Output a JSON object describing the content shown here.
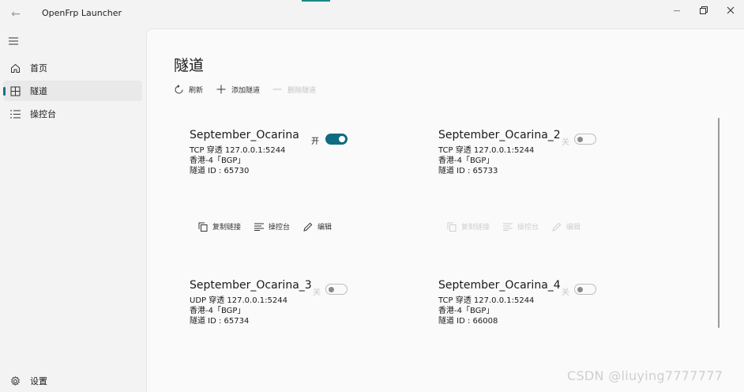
{
  "window": {
    "title": "OpenFrp Launcher",
    "back_glyph": "←",
    "min_glyph": "—"
  },
  "nav": {
    "items": [
      {
        "label": "首页",
        "icon": "home-icon"
      },
      {
        "label": "隧道",
        "icon": "tunnel-grid-icon",
        "active": true
      },
      {
        "label": "操控台",
        "icon": "console-list-icon"
      }
    ],
    "settings_label": "设置"
  },
  "page": {
    "title": "隧道",
    "toolbar": {
      "refresh_label": "刷新",
      "add_label": "添加隧道",
      "delete_label": "删除隧道"
    }
  },
  "tunnels": [
    {
      "name": "September_Ocarina",
      "line1": "TCP 穿透 127.0.0.1:5244",
      "line2": "香港-4「BGP」",
      "line3": "隧道 ID : 65730",
      "toggle_label": "开",
      "enabled": true,
      "actions": {
        "copy": "复制链接",
        "console": "操控台",
        "edit": "编辑"
      }
    },
    {
      "name": "September_Ocarina_2",
      "line1": "TCP 穿透 127.0.0.1:5244",
      "line2": "香港-4「BGP」",
      "line3": "隧道 ID : 65733",
      "toggle_label": "关",
      "enabled": false,
      "actions": {
        "copy": "复制链接",
        "console": "操控台",
        "edit": "编辑"
      }
    },
    {
      "name": "September_Ocarina_3",
      "line1": "UDP 穿透 127.0.0.1:5244",
      "line2": "香港-4「BGP」",
      "line3": "隧道 ID : 65734",
      "toggle_label": "关",
      "enabled": false
    },
    {
      "name": "September_Ocarina_4",
      "line1": "TCP 穿透 127.0.0.1:5244",
      "line2": "香港-4「BGP」",
      "line3": "隧道 ID : 66008",
      "toggle_label": "关",
      "enabled": false
    }
  ],
  "watermark": "CSDN @liuying7777777",
  "colors": {
    "accent": "#0f6b81",
    "background": "#f3f3f3",
    "content": "#fafafa"
  }
}
